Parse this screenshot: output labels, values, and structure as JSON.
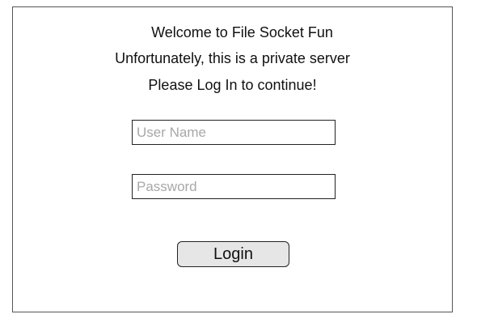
{
  "header": {
    "welcome": "Welcome to File Socket Fun",
    "notice": "Unfortunately, this is a private server",
    "instruction": "Please Log In to continue!"
  },
  "form": {
    "username_placeholder": "User Name",
    "username_value": "",
    "password_placeholder": "Password",
    "password_value": "",
    "login_label": "Login"
  },
  "colors": {
    "border": "#555555",
    "field_border": "#222222",
    "placeholder": "#a8a8a8",
    "button_bg": "#e6e6e6"
  }
}
